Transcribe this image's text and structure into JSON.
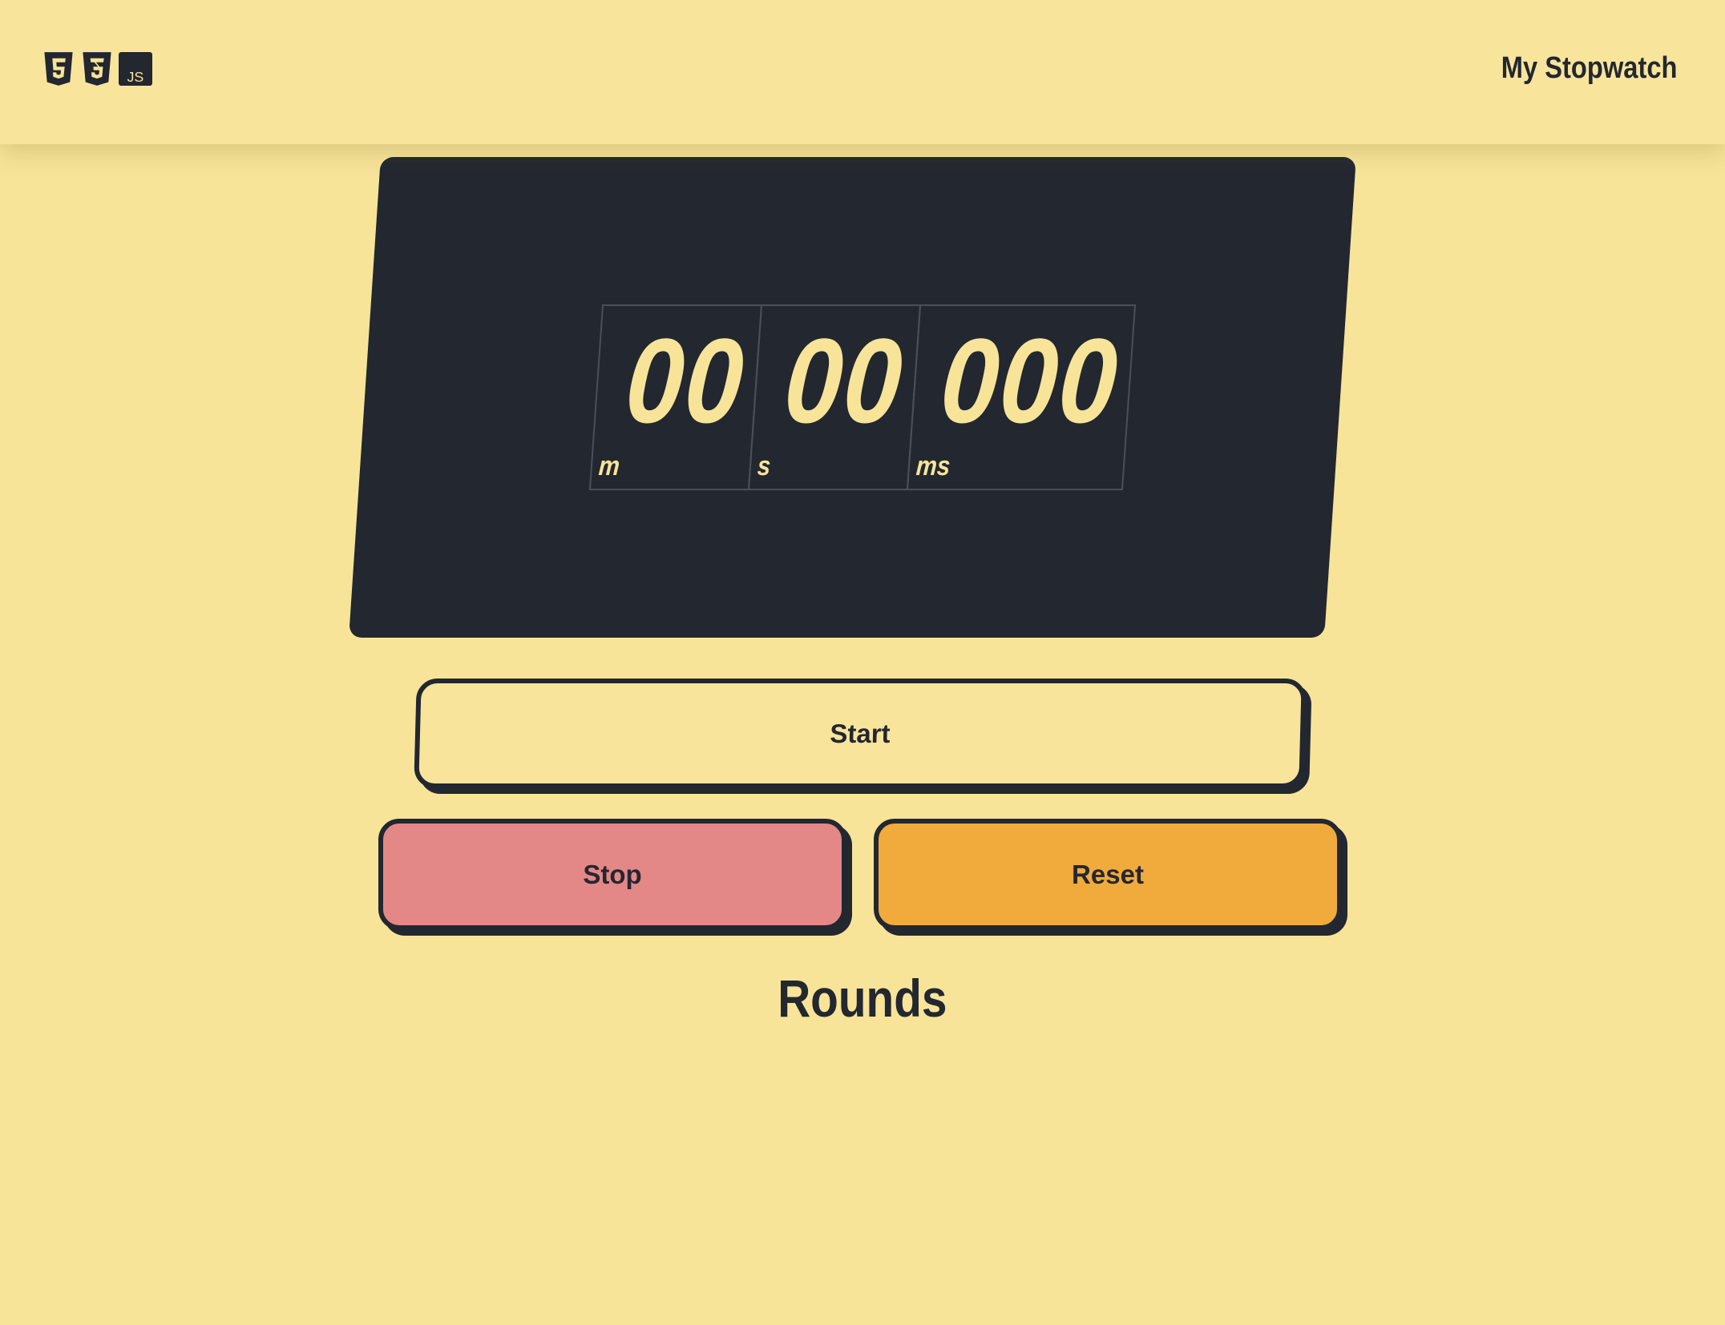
{
  "header": {
    "title": "My Stopwatch",
    "tech_icons": [
      "html5-icon",
      "css3-icon",
      "javascript-icon"
    ],
    "js_badge_text": "JS"
  },
  "display": {
    "minutes": "00",
    "seconds": "00",
    "milliseconds": "000",
    "minutes_unit": "m",
    "seconds_unit": "s",
    "milliseconds_unit": "ms"
  },
  "controls": {
    "start_label": "Start",
    "stop_label": "Stop",
    "reset_label": "Reset"
  },
  "rounds": {
    "title": "Rounds",
    "items": []
  },
  "colors": {
    "background": "#f7e498",
    "dark": "#232730",
    "accent_text": "#f7e498",
    "stop": "#e48787",
    "reset": "#f1aa3c"
  }
}
